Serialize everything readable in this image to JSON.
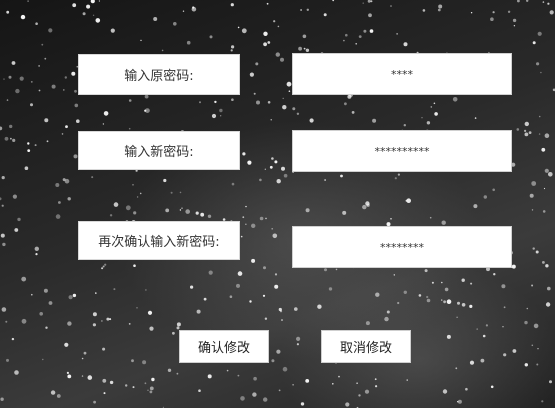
{
  "form": {
    "old_password": {
      "label": "输入原密码:",
      "value": "****"
    },
    "new_password": {
      "label": "输入新密码:",
      "value": "**********"
    },
    "confirm_password": {
      "label": "再次确认输入新密码:",
      "value": "********"
    }
  },
  "buttons": {
    "confirm_label": "确认修改",
    "cancel_label": "取消修改"
  }
}
